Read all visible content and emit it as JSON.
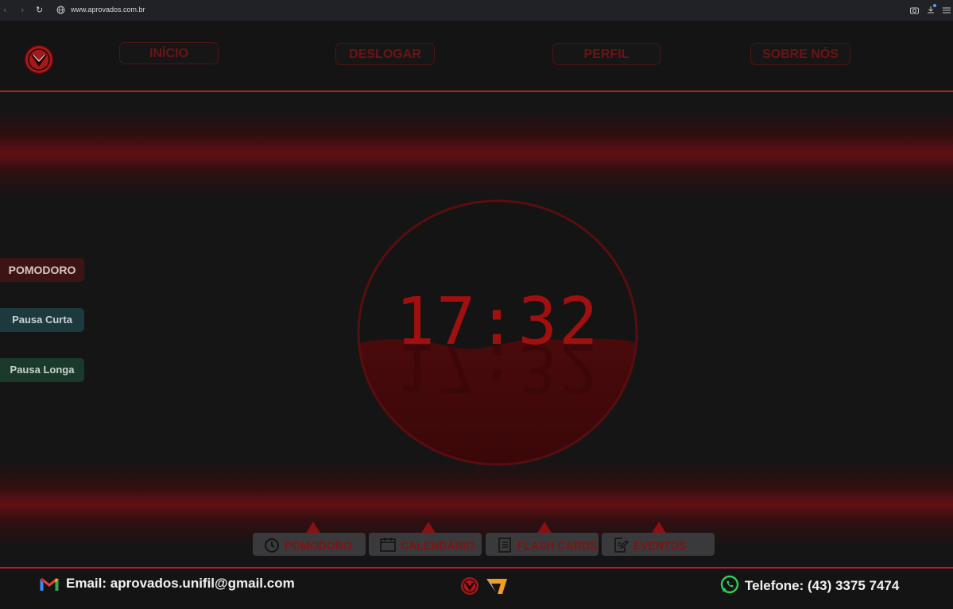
{
  "browser": {
    "url": "www.aprovados.com.br"
  },
  "nav": {
    "items": [
      {
        "label": "INÍCIO"
      },
      {
        "label": "DESLOGAR"
      },
      {
        "label": "PERFIL"
      },
      {
        "label": "SOBRE NÓS"
      }
    ]
  },
  "timer": {
    "modes": [
      {
        "label": "POMODORO"
      },
      {
        "label": "Pausa Curta"
      },
      {
        "label": "Pausa Longa"
      }
    ],
    "time": "17:32"
  },
  "tabs": [
    {
      "label": "POMODORO",
      "icon": "clock-icon"
    },
    {
      "label": "CALENDÁRIO",
      "icon": "calendar-icon"
    },
    {
      "label": "FLASH CARDS",
      "icon": "notebook-icon"
    },
    {
      "label": "EVENTOS",
      "icon": "edit-document-icon"
    }
  ],
  "footer": {
    "email": "Email: aprovados.unifil@gmail.com",
    "phone": "Telefone: (43) 3375 7474"
  },
  "colors": {
    "accent": "#c21a1c",
    "background": "#141415",
    "pomodoro_mode": "#3d1414",
    "short_break_mode": "#1c3a3e",
    "long_break_mode": "#1b3a2c"
  }
}
